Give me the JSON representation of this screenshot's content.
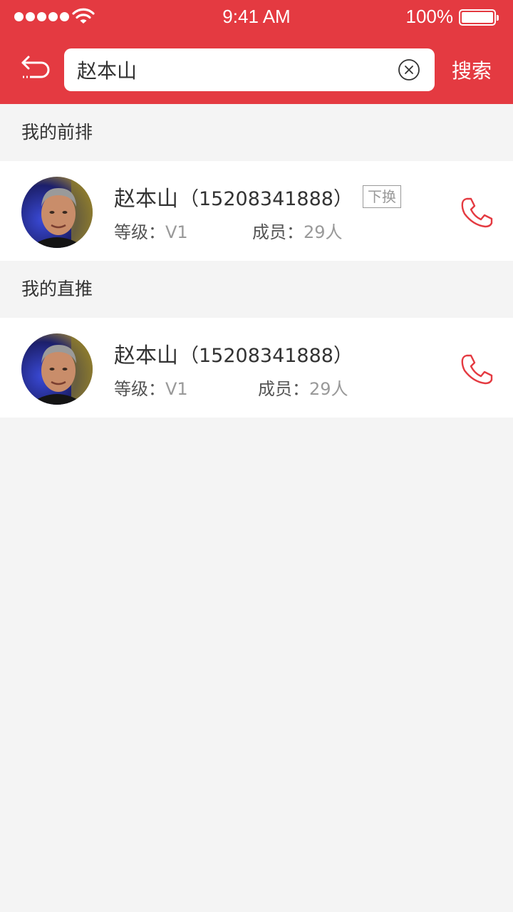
{
  "status_bar": {
    "time": "9:41 AM",
    "battery_percent": "100%",
    "battery_level": 1.0,
    "signal_dots": 5,
    "icons": [
      "signal-dots-icon",
      "wifi-icon",
      "battery-icon"
    ]
  },
  "nav": {
    "back_icon": "back-arrow-icon",
    "search": {
      "value": "赵本山",
      "placeholder": ""
    },
    "clear_icon": "clear-circle-x-icon",
    "search_label": "搜索"
  },
  "sections": [
    {
      "title": "我的前排",
      "items": [
        {
          "name": "赵本山",
          "phone": "（15208341888）",
          "tag": "下换",
          "level_label": "等级：",
          "level_value": "V1",
          "members_label": "成员：",
          "members_value": "29人",
          "call_icon": "phone-icon"
        }
      ]
    },
    {
      "title": "我的直推",
      "items": [
        {
          "name": "赵本山",
          "phone": "（15208341888）",
          "level_label": "等级：",
          "level_value": "V1",
          "members_label": "成员：",
          "members_value": "29人",
          "call_icon": "phone-icon"
        }
      ]
    }
  ],
  "colors": {
    "brand_red": "#e43a41",
    "background": "#f4f4f4",
    "text_dark": "#333333",
    "text_muted": "#999999"
  }
}
